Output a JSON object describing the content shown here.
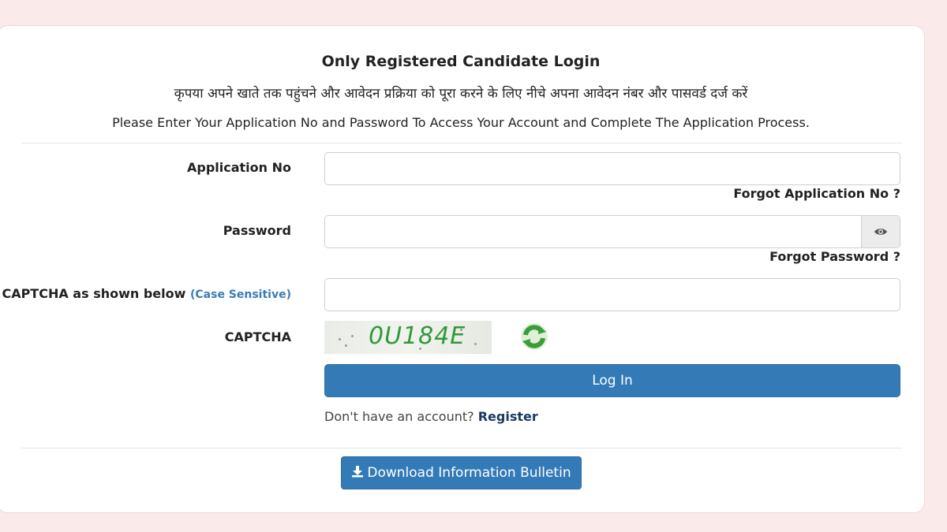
{
  "header": {
    "title": "Only Registered Candidate Login",
    "hindi_instruction": "कृपया अपने खाते तक पहुंचने और आवेदन प्रक्रिया को पूरा करने के लिए नीचे अपना आवेदन नंबर और पासवर्ड दर्ज करें",
    "english_instruction": "Please Enter Your Application No and Password To Access Your Account and Complete The Application Process."
  },
  "form": {
    "application_no_label": "Application No",
    "application_no_value": "",
    "forgot_application_no": "Forgot Application No ?",
    "password_label": "Password",
    "password_value": "",
    "forgot_password": "Forgot Password ?",
    "captcha_input_label": "CAPTCHA as shown below",
    "captcha_hint": "(Case Sensitive)",
    "captcha_input_value": "",
    "captcha_label": "CAPTCHA",
    "captcha_code": "0U184E",
    "login_button": "Log In",
    "no_account_text": "Don't have an account?",
    "register_link": "Register"
  },
  "footer": {
    "download_button": "Download Information Bulletin"
  },
  "icons": {
    "eye": "eye-icon",
    "refresh": "refresh-icon",
    "download": "download-icon"
  },
  "colors": {
    "primary": "#337ab7",
    "background": "#fbeaea",
    "captcha_green": "#2f9a3a",
    "hint_blue": "#3a7bb5"
  }
}
